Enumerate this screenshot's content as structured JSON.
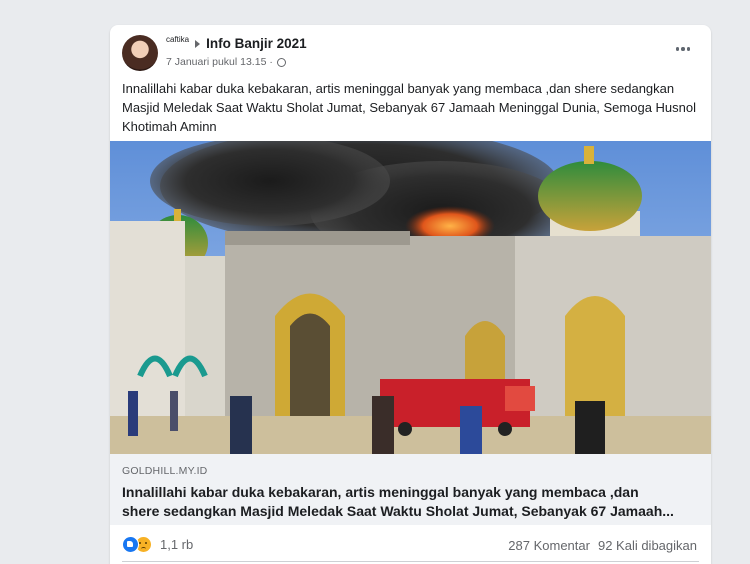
{
  "post": {
    "user_tag": "caftika",
    "group": "Info Banjir 2021",
    "timestamp": "7 Januari pukul 13.15 ·",
    "privacy_icon": "globe-icon",
    "text": "Innalillahi kabar duka kebakaran, artis meninggal banyak yang membaca ,dan shere sedangkan Masjid Meledak Saat Waktu Sholat Jumat, Sebanyak 67 Jamaah Meninggal Dunia, Semoga Husnol Khotimah Aminn"
  },
  "link": {
    "domain": "GOLDHILL.MY.ID",
    "title": "Innalillahi kabar duka kebakaran, artis meninggal banyak yang membaca ,dan\nshere sedangkan Masjid Meledak Saat Waktu Sholat Jumat, Sebanyak 67 Jamaah..."
  },
  "stats": {
    "reaction_count": "1,1 rb",
    "comments": "287 Komentar",
    "shares": "92 Kali dibagikan"
  },
  "colors": {
    "page_bg": "#e9ebee",
    "card_bg": "#ffffff",
    "text": "#1c1e21",
    "secondary_text": "#65676b",
    "link_bg": "#f0f2f5",
    "like_blue": "#1877f2"
  }
}
